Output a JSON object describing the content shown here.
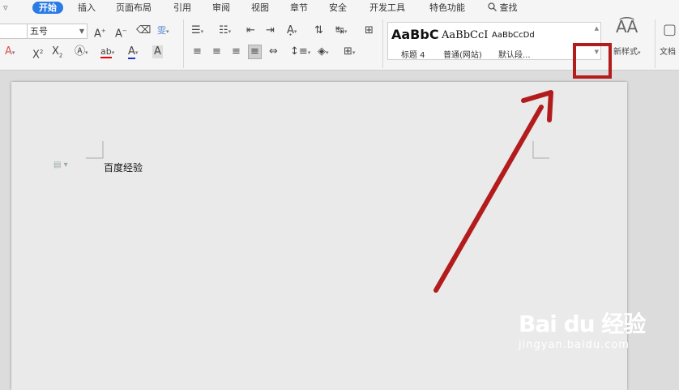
{
  "tabs": {
    "active": "开始",
    "items": [
      "插入",
      "页面布局",
      "引用",
      "审阅",
      "视图",
      "章节",
      "安全",
      "开发工具",
      "特色功能"
    ],
    "search_label": "查找"
  },
  "font": {
    "size_value": "五号"
  },
  "styles": {
    "previews": [
      "AaBbC",
      "AaBbCcI",
      "AaBbCcDd"
    ],
    "names": [
      "标题 4",
      "普通(网站)",
      "默认段..."
    ],
    "panel_label": "新样式",
    "doc_label": "文档"
  },
  "document": {
    "text": "百度经验"
  },
  "watermark": {
    "logo": "Bai du 经验",
    "url": "jingyan.baidu.com"
  },
  "colors": {
    "accent": "#2a7be4",
    "annotation_red": "#b31c1c"
  }
}
